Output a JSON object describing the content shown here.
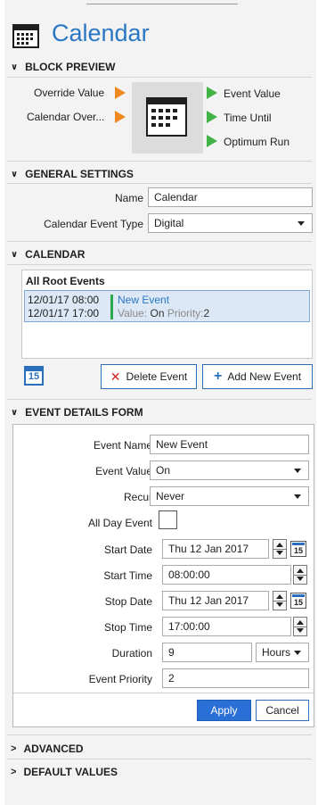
{
  "header": {
    "title": "Calendar",
    "icon": "calendar-icon"
  },
  "sections": {
    "block_preview": "BLOCK PREVIEW",
    "general_settings": "GENERAL SETTINGS",
    "calendar": "CALENDAR",
    "event_details": "EVENT DETAILS FORM",
    "advanced": "ADVANCED",
    "default_values": "DEFAULT VALUES"
  },
  "block_preview": {
    "inputs": [
      "Override Value",
      "Calendar Over..."
    ],
    "outputs": [
      "Event Value",
      "Time Until",
      "Optimum Run"
    ],
    "colors": {
      "input_port": "#ef8a21",
      "output_port": "#41b346"
    }
  },
  "general": {
    "name_label": "Name",
    "name_value": "Calendar",
    "type_label": "Calendar Event Type",
    "type_value": "Digital"
  },
  "calendar": {
    "list_header": "All Root Events",
    "event": {
      "start": "12/01/17 08:00",
      "end": "12/01/17 17:00",
      "name": "New Event",
      "value_label": "Value:",
      "value": "On",
      "priority_label": "Priority:",
      "priority": "2"
    },
    "today_icon_text": "15",
    "delete_label": "Delete Event",
    "add_label": "Add New Event"
  },
  "form": {
    "event_name_label": "Event Name",
    "event_name": "New Event",
    "event_value_label": "Event Value",
    "event_value": "On",
    "recur_label": "Recur",
    "recur": "Never",
    "all_day_label": "All Day Event",
    "start_date_label": "Start Date",
    "start_date": "Thu 12 Jan 2017",
    "start_time_label": "Start Time",
    "start_time": "08:00:00",
    "stop_date_label": "Stop Date",
    "stop_date": "Thu 12 Jan 2017",
    "stop_time_label": "Stop Time",
    "stop_time": "17:00:00",
    "duration_label": "Duration",
    "duration": "9",
    "duration_unit": "Hours",
    "priority_label": "Event Priority",
    "priority": "2",
    "cal_icon_text": "15",
    "apply_label": "Apply",
    "cancel_label": "Cancel"
  },
  "colors": {
    "accent": "#2a77c4",
    "apply_bg": "#2a6fd6",
    "selection_bg": "#dce8f5",
    "event_bar": "#2aa84a"
  }
}
